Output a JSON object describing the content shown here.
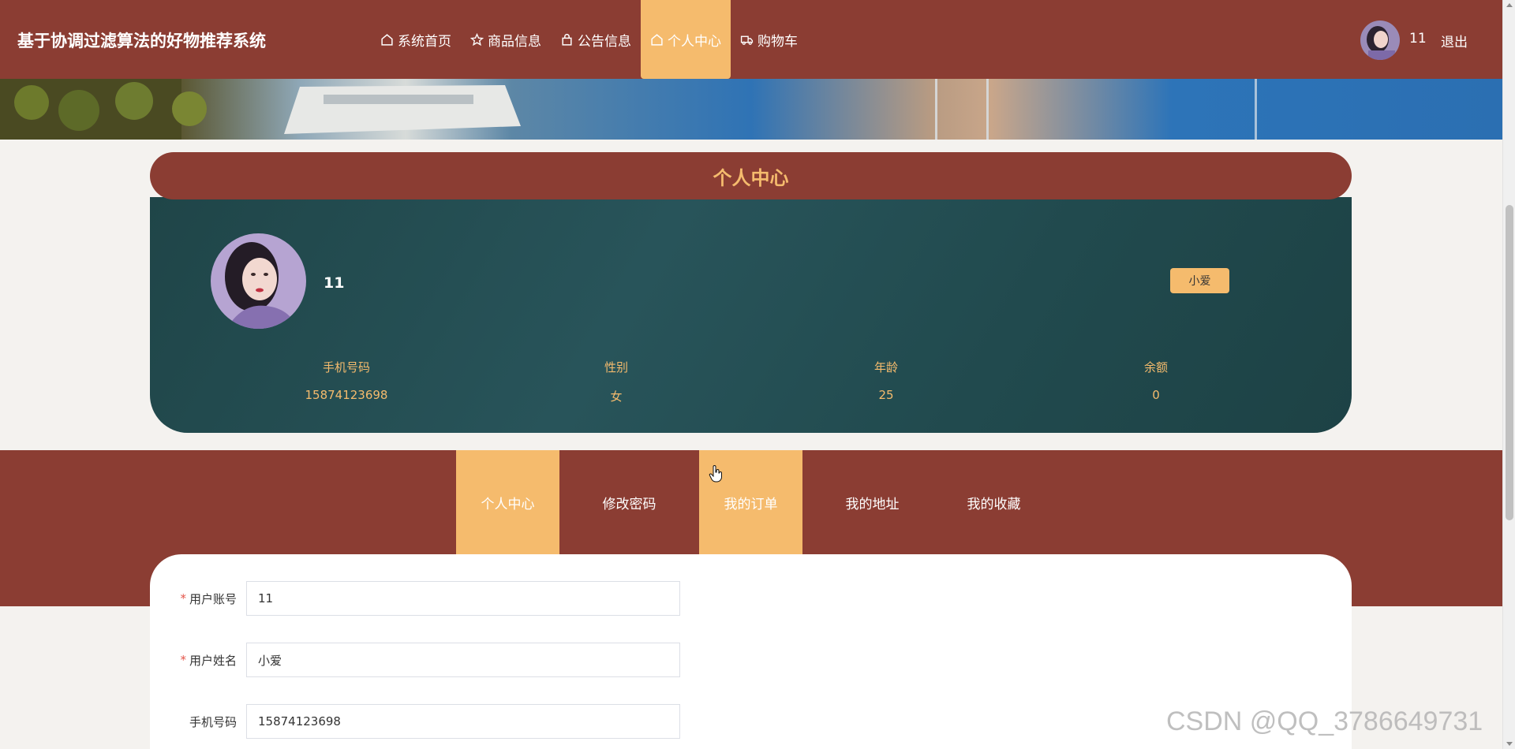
{
  "header": {
    "site_title": "基于协调过滤算法的好物推荐系统",
    "nav": [
      {
        "label": "系统首页",
        "icon": "home-icon"
      },
      {
        "label": "商品信息",
        "icon": "star-icon"
      },
      {
        "label": "公告信息",
        "icon": "bag-icon"
      },
      {
        "label": "个人中心",
        "icon": "home-icon",
        "active": true
      },
      {
        "label": "购物车",
        "icon": "truck-icon"
      }
    ],
    "username": "11",
    "logout_label": "退出"
  },
  "profile": {
    "section_title": "个人中心",
    "name": "11",
    "badge": "小爱",
    "stats": [
      {
        "label": "手机号码",
        "value": "15874123698"
      },
      {
        "label": "性别",
        "value": "女"
      },
      {
        "label": "年龄",
        "value": "25"
      },
      {
        "label": "余额",
        "value": "0"
      }
    ]
  },
  "tabs": [
    {
      "label": "个人中心",
      "active": true
    },
    {
      "label": "修改密码",
      "active": false
    },
    {
      "label": "我的订单",
      "active": true
    },
    {
      "label": "我的地址",
      "active": false
    },
    {
      "label": "我的收藏",
      "active": false
    }
  ],
  "form": {
    "fields": [
      {
        "label": "用户账号",
        "required": true,
        "value": "11"
      },
      {
        "label": "用户姓名",
        "required": true,
        "value": "小爱"
      },
      {
        "label": "手机号码",
        "required": false,
        "value": "15874123698"
      }
    ]
  },
  "watermark": "CSDN @QQ_3786649731",
  "colors": {
    "primary": "#8b3d33",
    "accent": "#f5bb6d",
    "card": "#22494d"
  }
}
